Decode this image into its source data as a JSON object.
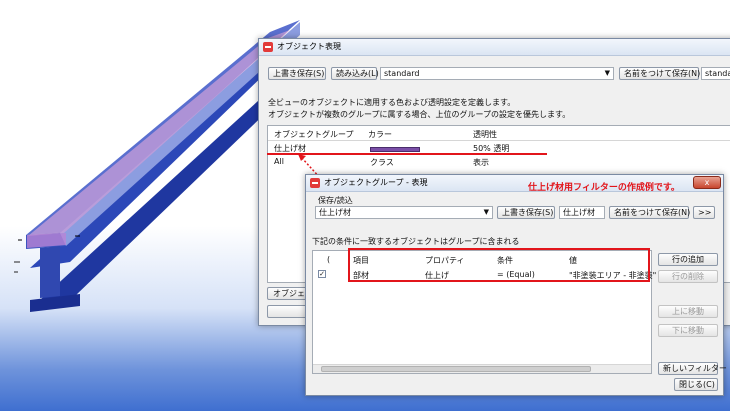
{
  "main_window": {
    "title": "オブジェクト表現",
    "overwrite_save": "上書き保存(S)",
    "load": "読み込み(L)",
    "preset_value": "standard",
    "save_as": "名前をつけて保存(N)",
    "preset_value_right": "standard",
    "description_1": "全ビューのオブジェクトに適用する色および透明設定を定義します。",
    "description_2": "オブジェクトが複数のグループに属する場合、上位のグループの設定を優先します。",
    "columns": [
      "オブジェクトグループ",
      "カラー",
      "透明性"
    ],
    "rows": [
      {
        "group": "仕上げ材",
        "color": "#7b4fa8",
        "transparency": "50% 透明"
      },
      {
        "group": "All",
        "color_label": "クラス",
        "transparency": "表示"
      }
    ],
    "bottom_button": "オブジェ"
  },
  "annotation": "仕上げ材用フィルターの作成例です。",
  "group_window": {
    "title": "オブジェクトグループ - 表現",
    "save_load_label": "保存/読込",
    "preset_value": "仕上げ材",
    "overwrite_save": "上書き保存(S)",
    "name_value": "仕上げ材",
    "save_as": "名前をつけて保存(N)",
    "more": ">>",
    "condition_text": "下記の条件に一致するオブジェクトはグループに含まれる",
    "columns": [
      "(",
      "項目",
      "プロパティ",
      "条件",
      "値"
    ],
    "rows": [
      {
        "checked": true,
        "item": "部材",
        "property": "仕上げ",
        "condition": "= (Equal)",
        "value": "\"非塗装エリア - 非塗装\""
      }
    ],
    "side_buttons": {
      "add_row": "行の追加",
      "delete_row": "行の削除",
      "move_up": "上に移動",
      "move_down": "下に移動",
      "new_filter": "新しいフィルター"
    },
    "close": "閉じる(C)",
    "title_close_glyph": "x"
  }
}
